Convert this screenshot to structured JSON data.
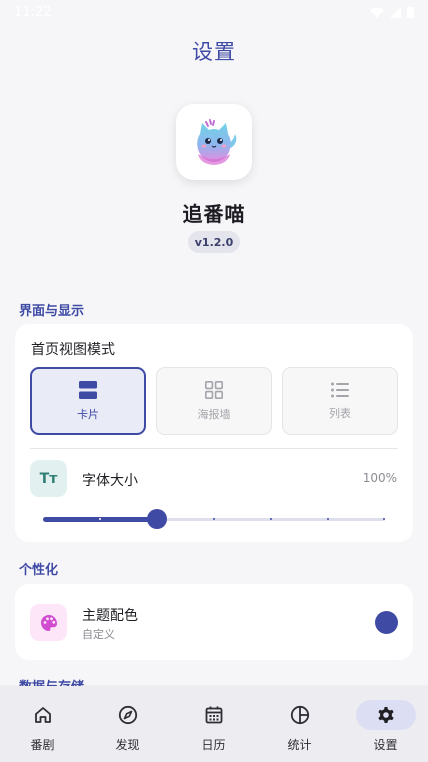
{
  "status_bar": {
    "time": "11:22"
  },
  "header": {
    "title": "设置"
  },
  "app": {
    "name": "追番喵",
    "version": "v1.2.0"
  },
  "sections": {
    "display": "界面与显示",
    "personal": "个性化",
    "data_storage": "数据与存储"
  },
  "home_view": {
    "label": "首页视图模式",
    "options": [
      {
        "label": "卡片",
        "icon": "card-view-icon",
        "selected": true
      },
      {
        "label": "海报墙",
        "icon": "grid-view-icon",
        "selected": false
      },
      {
        "label": "列表",
        "icon": "list-view-icon",
        "selected": false
      }
    ]
  },
  "font_size": {
    "label": "字体大小",
    "icon_text": "Tт",
    "value_label": "100%",
    "slider_fraction": 0.333,
    "steps": 7
  },
  "theme": {
    "label": "主题配色",
    "sublabel": "自定义",
    "color": "#3f4aa5"
  },
  "bottom_nav": [
    {
      "label": "番剧",
      "icon": "home-icon",
      "active": false
    },
    {
      "label": "发现",
      "icon": "compass-icon",
      "active": false
    },
    {
      "label": "日历",
      "icon": "calendar-icon",
      "active": false
    },
    {
      "label": "统计",
      "icon": "pie-chart-icon",
      "active": false
    },
    {
      "label": "设置",
      "icon": "gear-icon",
      "active": true
    }
  ],
  "colors": {
    "accent": "#3f4aa5",
    "background": "#f6f6f8",
    "nav_active_bg": "#dcdff4"
  }
}
